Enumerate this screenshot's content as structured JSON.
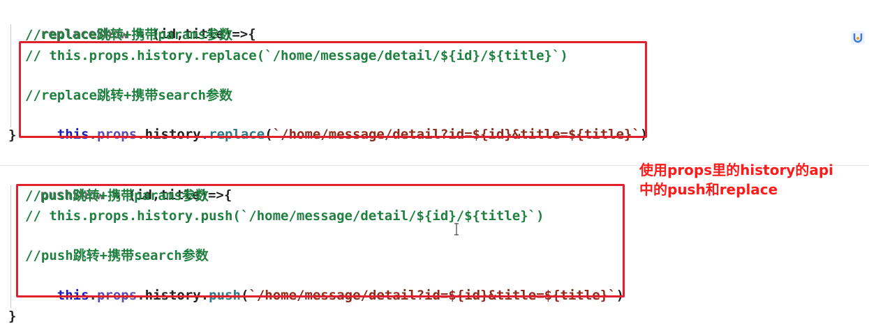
{
  "code": {
    "replace_block": {
      "signature": {
        "name": "replaceShow",
        "rest": " = (id,title)=>{"
      },
      "comment_params": "//replace跳转+携带params参数",
      "commented_call": "// this.props.history.replace(`/home/message/detail/${id}/${title}`)",
      "comment_search": "//replace跳转+携带search参数",
      "call": {
        "this": "this",
        "dot1": ".",
        "props": "props",
        "dot2": ".",
        "history": "history",
        "dot3": ".",
        "method": "replace",
        "open": "(",
        "string": "`/home/message/detail?id=${id}&title=${title}`",
        "close": ")"
      },
      "close": "}"
    },
    "push_block": {
      "signature": {
        "name": "pushShow",
        "rest": " = (id,title)=>{"
      },
      "comment_params": "//push跳转+携带params参数",
      "commented_call": "// this.props.history.push(`/home/message/detail/${id}/${title}`)",
      "comment_search": "//push跳转+携带search参数",
      "call": {
        "this": "this",
        "dot1": ".",
        "props": "props",
        "dot2": ".",
        "history": "history",
        "dot3": ".",
        "method": "push",
        "open": "(",
        "string": "`/home/message/detail?id=${id}&title=${title}`",
        "close": ")"
      },
      "close": "}"
    }
  },
  "annotation": {
    "line1": "使用props里的history的api",
    "line2": "中的push和replace"
  },
  "colors": {
    "highlight_box": "#e0202c",
    "annotation_text": "#ff1a1a",
    "comment": "#208040",
    "keyword": "#1b1bb5",
    "string": "#8a2d1d"
  },
  "icons": {
    "plugin": "plugin-icon",
    "cursor": "text-cursor-icon"
  }
}
